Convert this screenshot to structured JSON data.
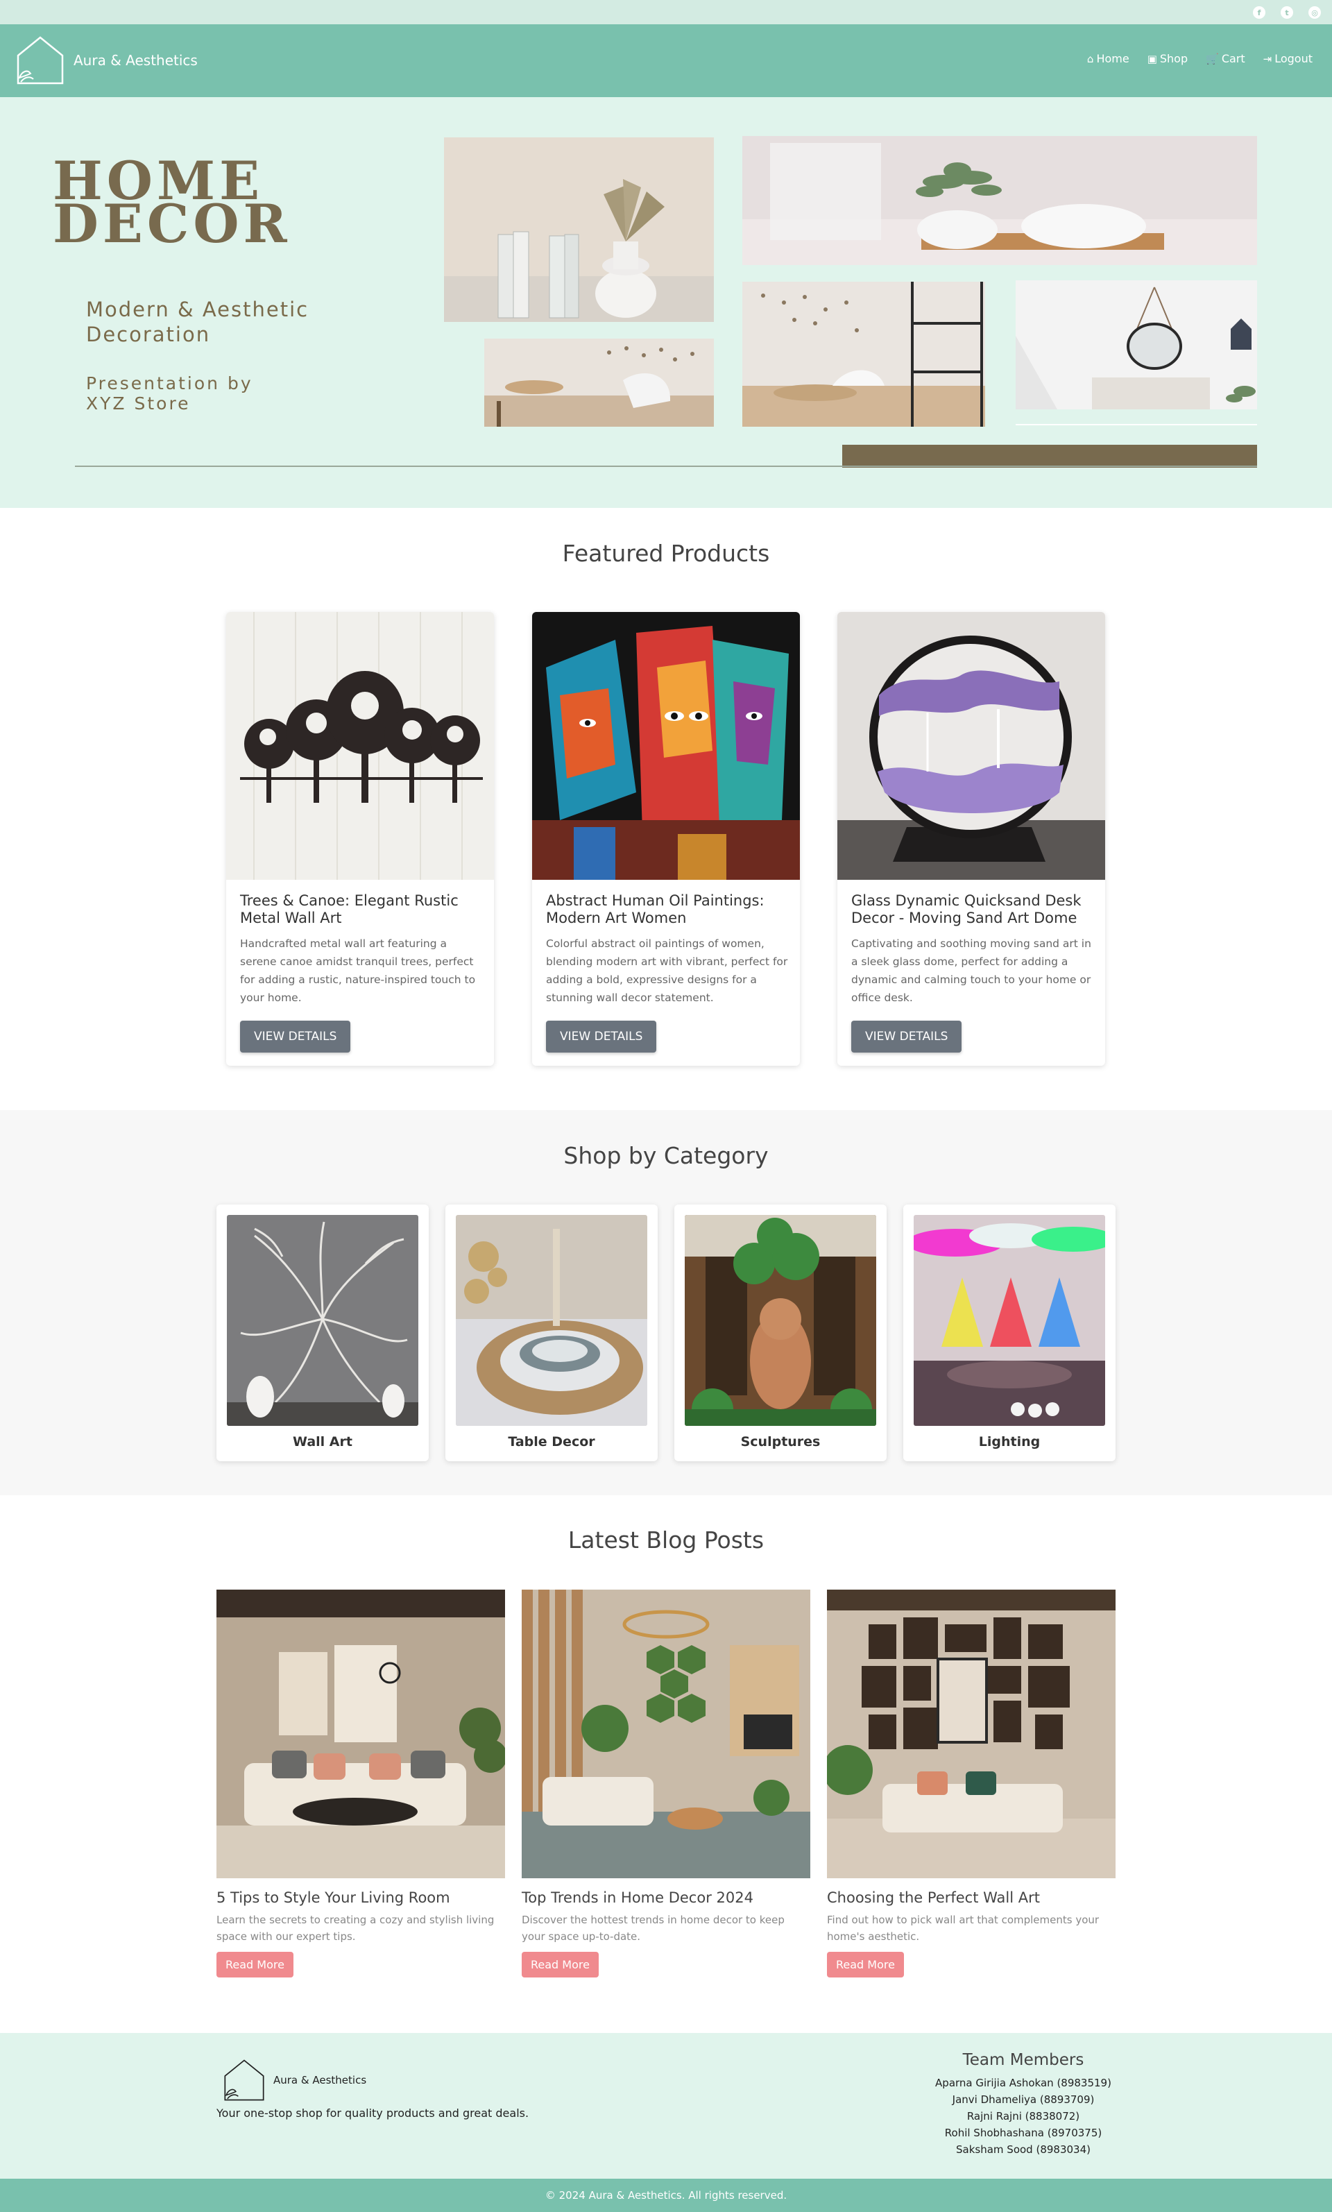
{
  "social": [
    {
      "icon": "facebook-icon",
      "glyph": "f"
    },
    {
      "icon": "twitter-icon",
      "glyph": "t"
    },
    {
      "icon": "instagram-icon",
      "glyph": "◎"
    }
  ],
  "nav": {
    "brand": "Aura & Aesthetics",
    "links": [
      {
        "icon": "home-icon",
        "glyph": "⌂",
        "label": "Home"
      },
      {
        "icon": "shop-icon",
        "glyph": "▣",
        "label": "Shop"
      },
      {
        "icon": "cart-icon",
        "glyph": "🛒",
        "label": "Cart"
      },
      {
        "icon": "logout-icon",
        "glyph": "⇥",
        "label": "Logout"
      }
    ]
  },
  "hero": {
    "title_line1": "HOME",
    "title_line2": "DECOR",
    "subtitle_line1": "Modern & Aesthetic",
    "subtitle_line2": "Decoration",
    "presentation_line1": "Presentation by",
    "presentation_line2": "XYZ Store"
  },
  "featured": {
    "title": "Featured Products",
    "products": [
      {
        "title": "Trees & Canoe: Elegant Rustic Metal Wall Art",
        "description": "Handcrafted metal wall art featuring a serene canoe amidst tranquil trees, perfect for adding a rustic, nature-inspired touch to your home.",
        "button": "VIEW DETAILS"
      },
      {
        "title": "Abstract Human Oil Paintings: Modern Art Women",
        "description": "Colorful abstract oil paintings of women, blending modern art with vibrant, perfect for adding a bold, expressive designs for a stunning wall decor statement.",
        "button": "VIEW DETAILS"
      },
      {
        "title": "Glass Dynamic Quicksand Desk Decor - Moving Sand Art Dome",
        "description": "Captivating and soothing moving sand art in a sleek glass dome, perfect for adding a dynamic and calming touch to your home or office desk.",
        "button": "VIEW DETAILS"
      }
    ]
  },
  "categories": {
    "title": "Shop by Category",
    "items": [
      {
        "label": "Wall Art"
      },
      {
        "label": "Table Decor"
      },
      {
        "label": "Sculptures"
      },
      {
        "label": "Lighting"
      }
    ]
  },
  "blog": {
    "title": "Latest Blog Posts",
    "posts": [
      {
        "title": "5 Tips to Style Your Living Room",
        "description": "Learn the secrets to creating a cozy and stylish living space with our expert tips.",
        "button": "Read More"
      },
      {
        "title": "Top Trends in Home Decor 2024",
        "description": "Discover the hottest trends in home decor to keep your space up-to-date.",
        "button": "Read More"
      },
      {
        "title": "Choosing the Perfect Wall Art",
        "description": "Find out how to pick wall art that complements your home's aesthetic.",
        "button": "Read More"
      }
    ]
  },
  "footer": {
    "brand": "Aura & Aesthetics",
    "tagline": "Your one-stop shop for quality products and great deals.",
    "team_title": "Team Members",
    "team": [
      "Aparna Girijia Ashokan (8983519)",
      "Janvi Dhameliya (8893709)",
      "Rajni Rajni (8838072)",
      "Rohil Shobhashana (8970375)",
      "Saksham Sood (8983034)"
    ],
    "copyright": "© 2024 Aura & Aesthetics. All rights reserved."
  },
  "colors": {
    "nav": "#79c1ad",
    "hero_bg": "#e0f4ec",
    "hero_accent": "#786a4e",
    "button_dark": "#6a737d",
    "button_pink": "#f08a8e"
  }
}
